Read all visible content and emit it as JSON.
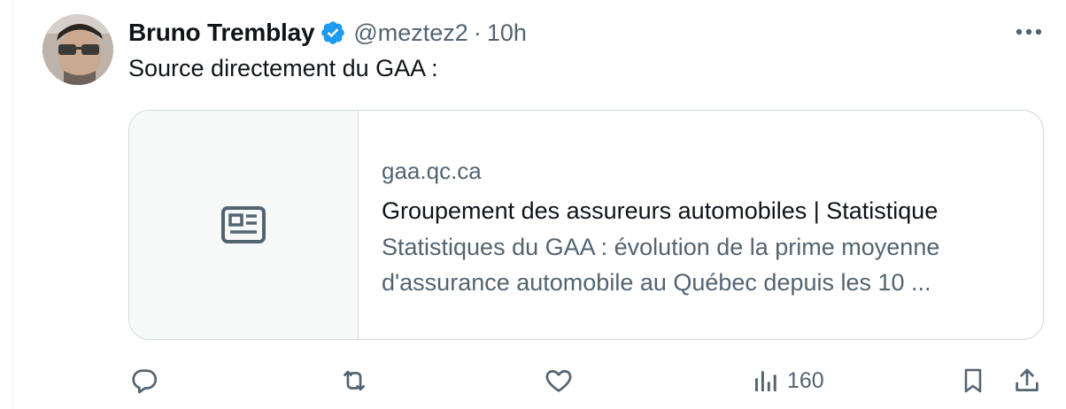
{
  "tweet": {
    "author_name": "Bruno Tremblay",
    "handle": "@meztez2",
    "separator": "·",
    "time": "10h",
    "text": "Source directement du GAA :",
    "verified_color": "#1d9bf0"
  },
  "card": {
    "domain": "gaa.qc.ca",
    "title": "Groupement des assureurs automobiles | Statistique",
    "description_line1": "Statistiques du GAA : évolution de la prime moyenne",
    "description_line2": "d'assurance automobile au Québec depuis les 10 ...",
    "media_icon": "news-article-icon"
  },
  "actions": {
    "reply_icon": "reply-icon",
    "retweet_icon": "retweet-icon",
    "like_icon": "heart-icon",
    "views_icon": "analytics-icon",
    "views_count": "160",
    "bookmark_icon": "bookmark-icon",
    "share_icon": "share-icon"
  },
  "colors": {
    "text_primary": "#0f1419",
    "text_secondary": "#536471",
    "border": "#cfd9de",
    "card_media_bg": "#f7f9f9"
  }
}
